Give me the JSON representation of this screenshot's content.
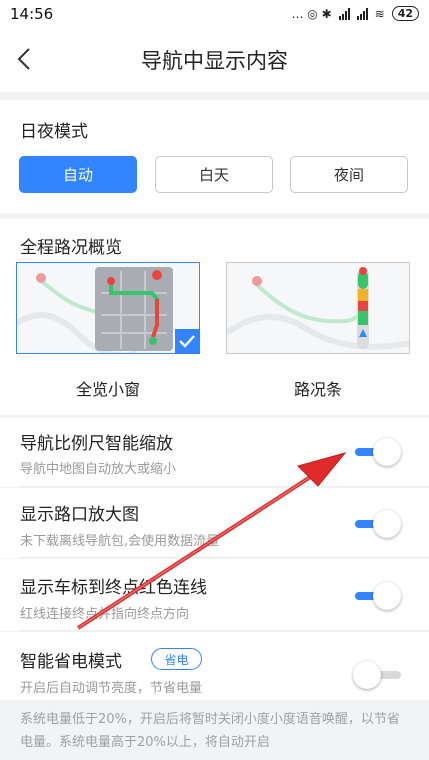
{
  "status_bar": {
    "time": "14:56",
    "indicators": "… ◎ ✱ ",
    "wifi_symbol": "≋",
    "battery": "42"
  },
  "header": {
    "title": "导航中显示内容",
    "back_icon": "chevron-left-icon"
  },
  "day_night": {
    "title": "日夜模式",
    "options": [
      "自动",
      "白天",
      "夜间"
    ],
    "selected": "自动"
  },
  "overview": {
    "title": "全程路况概览",
    "options": [
      {
        "label": "全览小窗",
        "selected": true
      },
      {
        "label": "路况条",
        "selected": false
      }
    ]
  },
  "settings": [
    {
      "title": "导航比例尺智能缩放",
      "subtitle": "导航中地图自动放大或缩小",
      "enabled": true
    },
    {
      "title": "显示路口放大图",
      "subtitle": "未下载离线导航包,会使用数据流量",
      "enabled": true
    },
    {
      "title": "显示车标到终点红色连线",
      "subtitle": "红线连接终点并指向终点方向",
      "enabled": true
    },
    {
      "title": "智能省电模式",
      "subtitle": "开启后自动调节亮度，节省电量",
      "badge": "省电",
      "enabled": false
    }
  ],
  "power_note": "系统电量低于20%，开启后将暂时关闭小度小度语音唤醒，以节省电量。系统电量高于20%以上，将自动开启",
  "colors": {
    "accent": "#3385ff",
    "annotation_arrow": "#e02b2b",
    "traffic_green": "#37c46b",
    "traffic_red": "#e8453c",
    "traffic_yellow": "#f5b323"
  }
}
